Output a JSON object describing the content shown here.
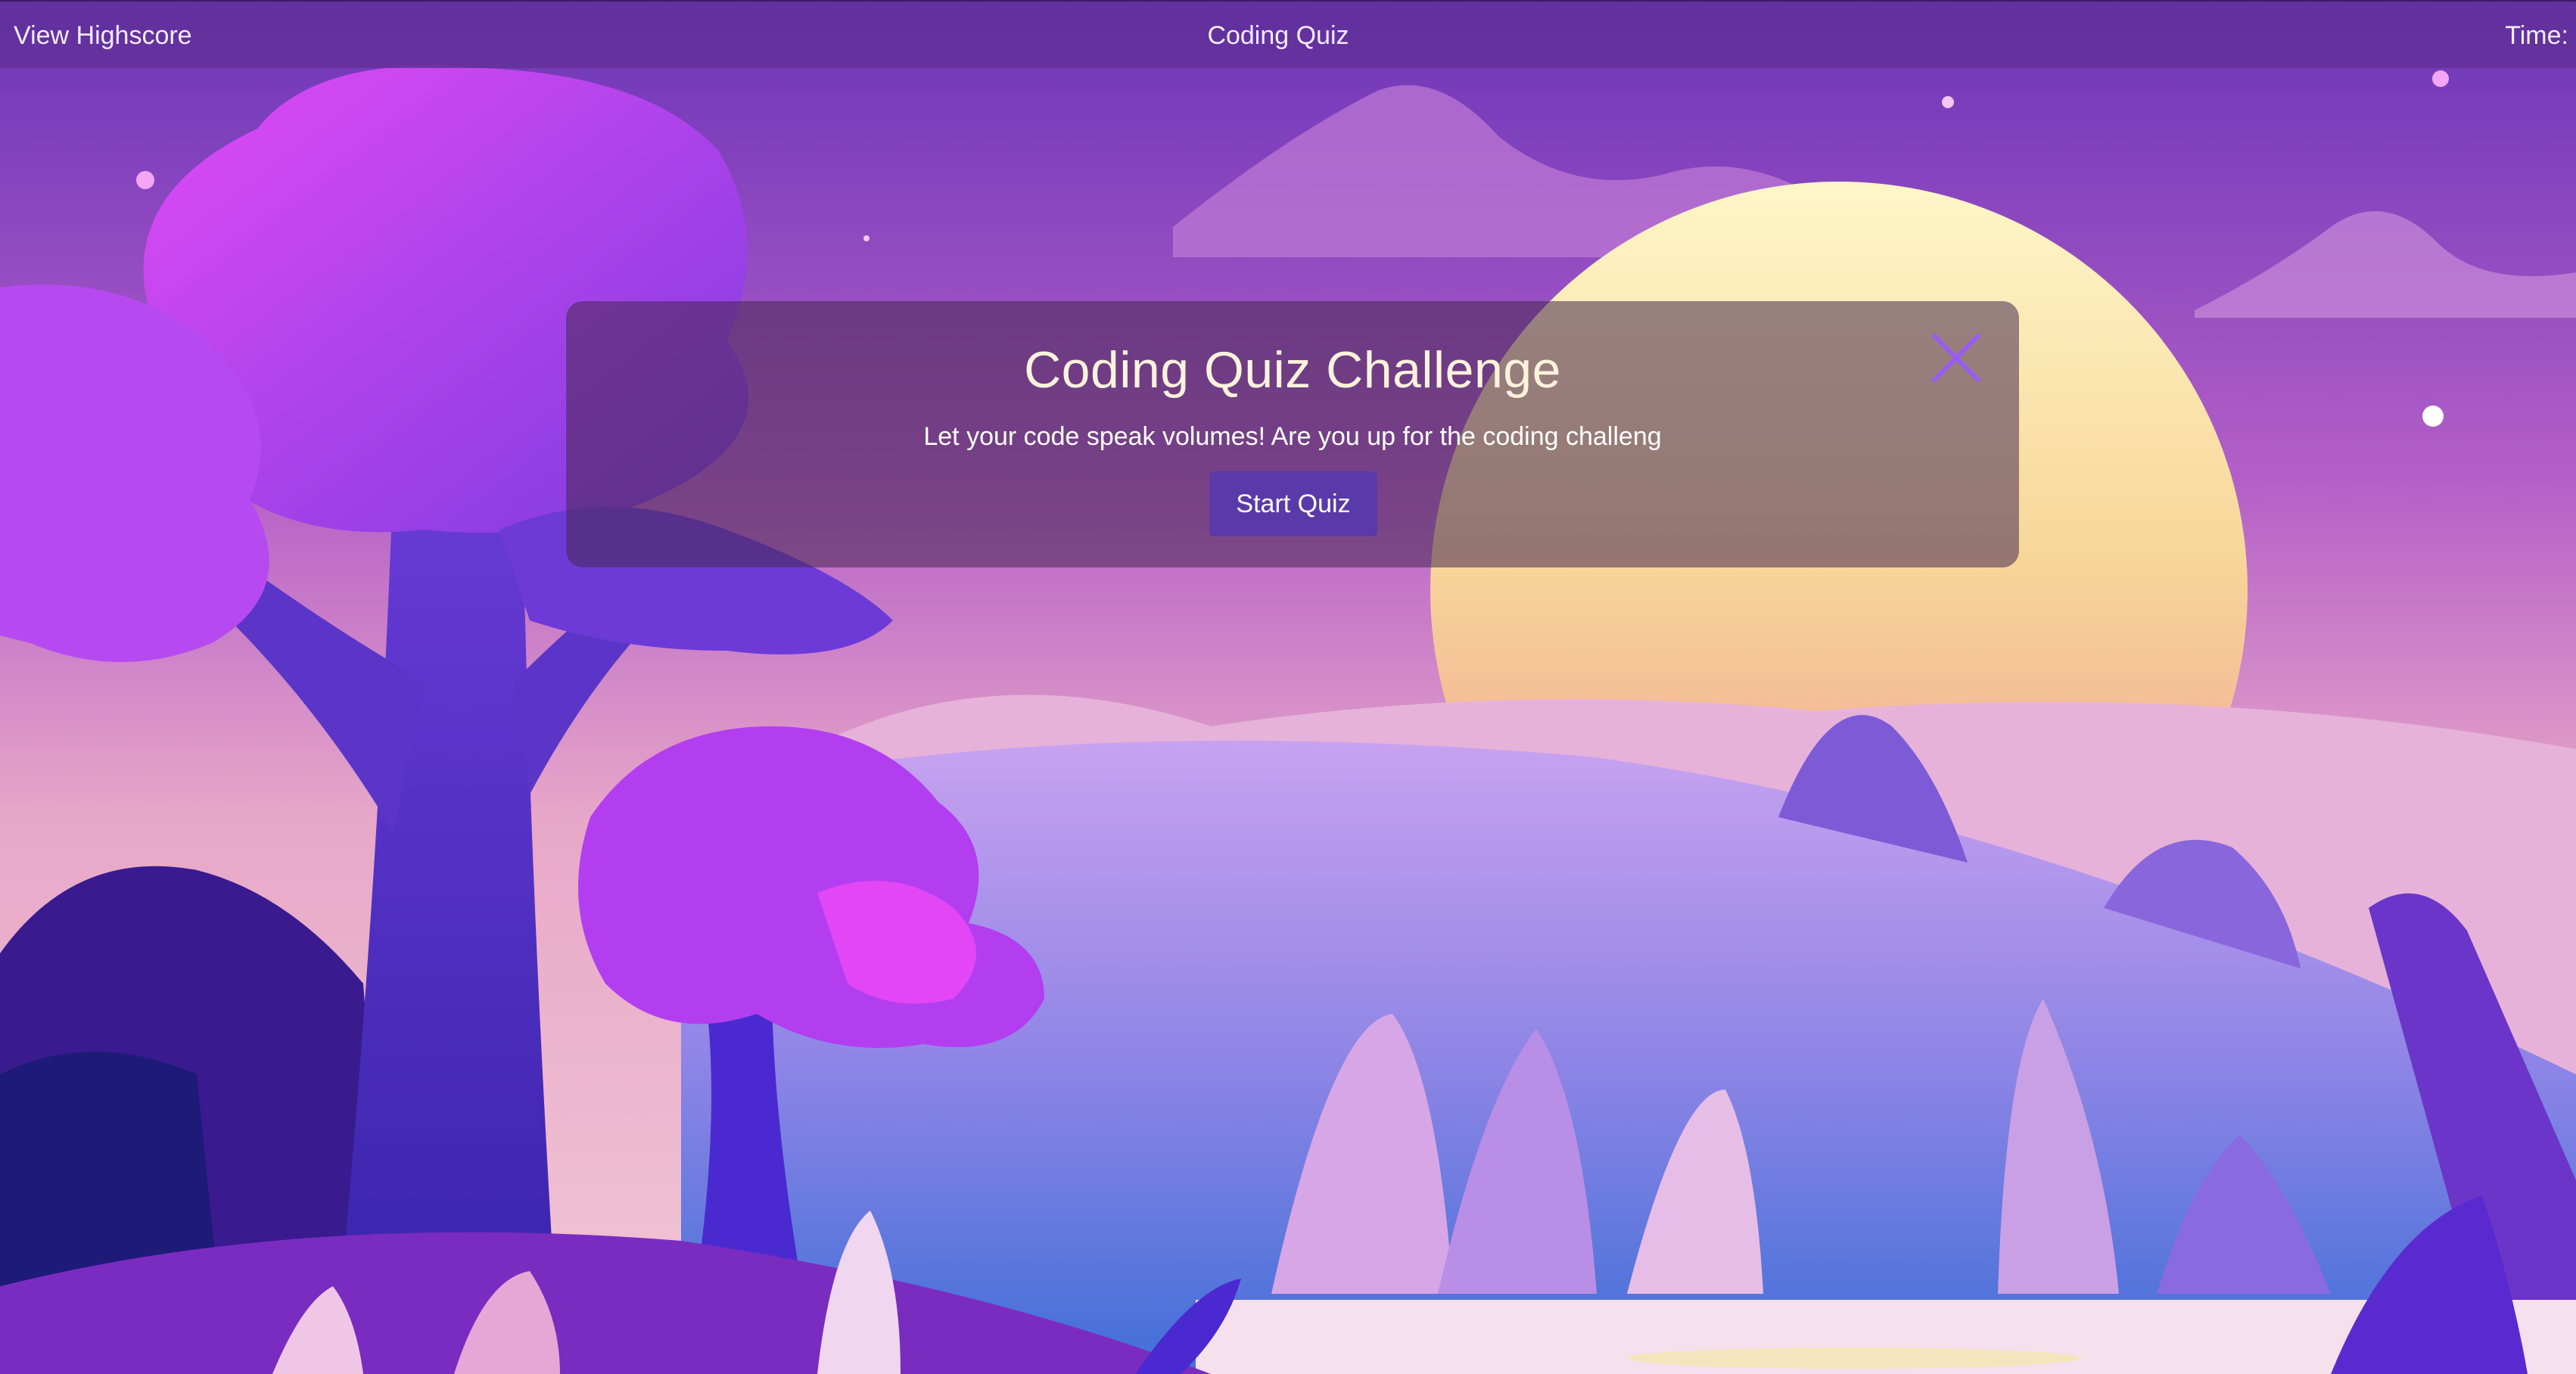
{
  "topbar": {
    "highscore_link": "View Highscore",
    "title": "Coding Quiz",
    "timer_label": "Time:"
  },
  "modal": {
    "title": "Coding Quiz Challenge",
    "description": "Let your code speak volumes! Are you up for the coding challeng",
    "start_button": "Start Quiz",
    "close_icon": "close-icon"
  },
  "colors": {
    "topbar_bg": "#603096",
    "button_bg": "#5a3aa8",
    "close_icon": "#9a5cf0",
    "title_text": "#fff3dc"
  }
}
